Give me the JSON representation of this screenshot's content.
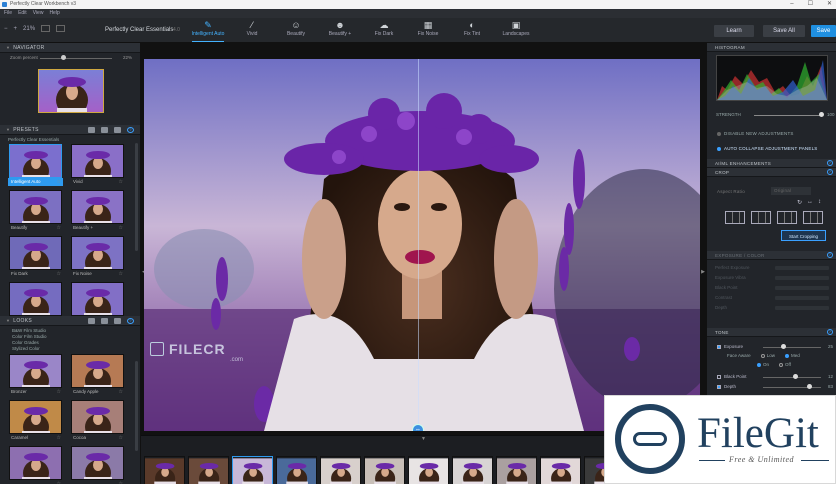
{
  "window": {
    "title": "Perfectly Clear Workbench v3",
    "controls": [
      "–",
      "☐",
      "✕"
    ]
  },
  "menu": [
    "File",
    "Edit",
    "View",
    "Help"
  ],
  "toolbar": {
    "zoom": "21%",
    "preset_name": "Perfectly Clear Essentials",
    "preset_version": "4.0",
    "tools": [
      {
        "label": "Intelligent Auto",
        "icon": "wand-icon",
        "glyph": "✎",
        "active": true
      },
      {
        "label": "Vivid",
        "icon": "brush-icon",
        "glyph": "⁄",
        "active": false
      },
      {
        "label": "Beautify",
        "icon": "face-icon",
        "glyph": "☺",
        "active": false
      },
      {
        "label": "Beautify +",
        "icon": "face-plus-icon",
        "glyph": "☻",
        "active": false
      },
      {
        "label": "Fix Dark",
        "icon": "cloud-icon",
        "glyph": "☁",
        "active": false
      },
      {
        "label": "Fix Noise",
        "icon": "noise-icon",
        "glyph": "▦",
        "active": false
      },
      {
        "label": "Fix Tint",
        "icon": "tint-icon",
        "glyph": "◐",
        "active": false
      },
      {
        "label": "Landscapes",
        "icon": "landscape-icon",
        "glyph": "▣",
        "active": false
      }
    ],
    "learn_label": "Learn",
    "save_all_label": "Save All",
    "save_label": "Save"
  },
  "navigator": {
    "title": "NAVIGATOR",
    "zoom_label": "Zoom percent",
    "zoom_value": "22%"
  },
  "presets": {
    "title": "PRESETS",
    "group": "Perfectly Clear Essentials",
    "items": [
      {
        "label": "Intelligent Auto",
        "selected": true
      },
      {
        "label": "Vivid",
        "selected": false
      },
      {
        "label": "Beautify",
        "selected": false
      },
      {
        "label": "Beautify +",
        "selected": false
      },
      {
        "label": "Fix Dark",
        "selected": false
      },
      {
        "label": "Fix Noise",
        "selected": false
      },
      {
        "label": "",
        "selected": false
      },
      {
        "label": "",
        "selected": false
      }
    ]
  },
  "looks": {
    "title": "LOOKS",
    "groups": [
      "B&W Film Studio",
      "Color Film Studio",
      "Color Grades",
      "Stylized Color"
    ],
    "items": [
      {
        "label": "Bronzer"
      },
      {
        "label": "Candy Apple"
      },
      {
        "label": "Caramel"
      },
      {
        "label": "Cocoa"
      },
      {
        "label": ""
      },
      {
        "label": ""
      }
    ]
  },
  "canvas": {
    "watermark_text": "FILECR",
    "watermark_sub": ".com",
    "split_knob": "⇔"
  },
  "filmstrip": {
    "count": 13
  },
  "right": {
    "histogram_title": "HISTOGRAM",
    "strength_label": "STRENGTH",
    "strength_value": "100",
    "strength_fraction": 1.0,
    "opt1": "DISABLE NEW ADJUSTMENTS",
    "opt2": "AUTO COLLAPSE ADJUSTMENT PANELS",
    "sec_ai": "AI/ML ENHANCEMENTS",
    "sec_crop": "CROP",
    "aspect_label": "Aspect Ratio",
    "aspect_value": "Original",
    "crop_button": "Start Cropping",
    "sec_exposure": "EXPOSURE / COLOR",
    "dim_rows": [
      "Perfect Exposure",
      "Exposure Vibra",
      "Black Point",
      "Contrast",
      "Depth"
    ],
    "sec_tone": "TONE",
    "tone": [
      {
        "label": "Exposure",
        "value": "25",
        "checked": true,
        "pos": 0.35
      },
      {
        "label": "Black Point",
        "value": "12",
        "checked": false,
        "pos": 0.55
      },
      {
        "label": "Depth",
        "value": "83",
        "checked": true,
        "pos": 0.8
      }
    ],
    "face_aware_label": "Face Aware",
    "radio1": [
      "Low",
      "Med",
      "High"
    ],
    "radio2": [
      "On",
      "Off"
    ]
  },
  "badge": {
    "title": "FileGit",
    "subtitle": "Free & Unlimited"
  }
}
